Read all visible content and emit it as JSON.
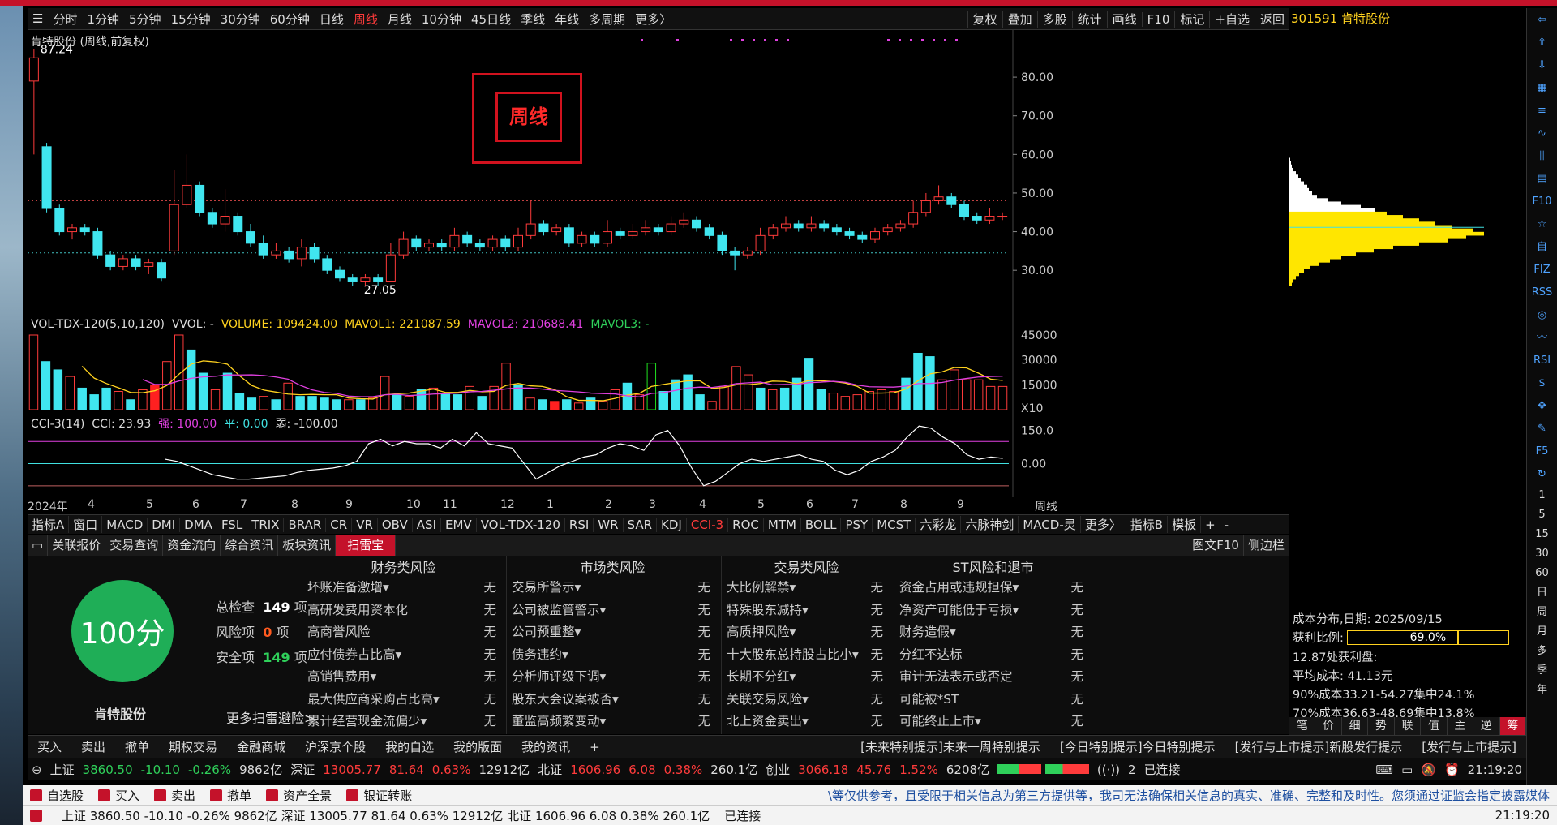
{
  "periods": [
    "分时",
    "1分钟",
    "5分钟",
    "15分钟",
    "30分钟",
    "60分钟",
    "日线",
    "周线",
    "月线",
    "10分钟",
    "45日线",
    "季线",
    "年线",
    "多周期",
    "更多〉"
  ],
  "active_period": "周线",
  "toolbar": [
    "复权",
    "叠加",
    "多股",
    "统计",
    "画线",
    "F10",
    "标记",
    "+自选",
    "返回"
  ],
  "stock": {
    "code": "301591",
    "name": "肯特股份",
    "title": "肯特股份 (周线,前复权)",
    "max_label": "87.24",
    "min_label": "27.05",
    "overlay_label": "周线"
  },
  "price_axis": [
    "80.00",
    "70.00",
    "60.00",
    "50.00",
    "40.00",
    "30.00"
  ],
  "vol_legend": {
    "name": "VOL-TDX-120(5,10,120)",
    "vvol": "VVOL: -",
    "volume": "VOLUME: 109424.00",
    "mavol1": "MAVOL1: 221087.59",
    "mavol2": "MAVOL2: 210688.41",
    "mavol3": "MAVOL3: -"
  },
  "vol_axis": [
    "45000",
    "30000",
    "15000",
    "X10"
  ],
  "cci_legend": {
    "name": "CCI-3(14)",
    "cci": "CCI: 23.93",
    "strong": "强: 100.00",
    "flat": "平: 0.00",
    "weak": "弱: -100.00"
  },
  "cci_axis": [
    "150.0",
    "0.00"
  ],
  "x_axis": [
    "2024年",
    "4",
    "5",
    "6",
    "7",
    "8",
    "9",
    "10",
    "11",
    "12",
    "1",
    "2",
    "3",
    "4",
    "5",
    "6",
    "7",
    "8",
    "9",
    "周线"
  ],
  "indicator_tabs": [
    "指标A",
    "窗口",
    "MACD",
    "DMI",
    "DMA",
    "FSL",
    "TRIX",
    "BRAR",
    "CR",
    "VR",
    "OBV",
    "ASI",
    "EMV",
    "VOL-TDX-120",
    "RSI",
    "WR",
    "SAR",
    "KDJ",
    "CCI-3",
    "ROC",
    "MTM",
    "BOLL",
    "PSY",
    "MCST",
    "六彩龙",
    "六脉神剑",
    "MACD-灵",
    "更多〉",
    "指标B",
    "模板",
    "+",
    "-"
  ],
  "active_indicator": "CCI-3",
  "info_tabs": [
    "关联报价",
    "交易查询",
    "资金流向",
    "综合资讯",
    "板块资讯",
    "扫雷宝"
  ],
  "active_info": "扫雷宝",
  "info_right": [
    "图文F10",
    "侧边栏"
  ],
  "risk": {
    "score": "100分",
    "total_label": "总检查",
    "total": "149",
    "total_unit": "项",
    "risk_label": "风险项",
    "risk": "0",
    "risk_unit": "项",
    "safe_label": "安全项",
    "safe": "149",
    "safe_unit": "项",
    "name": "肯特股份",
    "more": "更多扫雷避险>",
    "columns": [
      {
        "title": "财务类风险",
        "items": [
          [
            "坏账准备激增▾",
            "无"
          ],
          [
            "高研发费用资本化",
            "无"
          ],
          [
            "高商誉风险",
            "无"
          ],
          [
            "应付债券占比高▾",
            "无"
          ],
          [
            "高销售费用▾",
            "无"
          ],
          [
            "最大供应商采购占比高▾",
            "无"
          ],
          [
            "累计经营现金流偏少▾",
            "无"
          ]
        ]
      },
      {
        "title": "市场类风险",
        "items": [
          [
            "交易所警示▾",
            "无"
          ],
          [
            "公司被监管警示▾",
            "无"
          ],
          [
            "公司预重整▾",
            "无"
          ],
          [
            "债务违约▾",
            "无"
          ],
          [
            "分析师评级下调▾",
            "无"
          ],
          [
            "股东大会议案被否▾",
            "无"
          ],
          [
            "董监高频繁变动▾",
            "无"
          ]
        ]
      },
      {
        "title": "交易类风险",
        "items": [
          [
            "大比例解禁▾",
            "无"
          ],
          [
            "特殊股东减持▾",
            "无"
          ],
          [
            "高质押风险▾",
            "无"
          ],
          [
            "十大股东总持股占比小▾",
            "无"
          ],
          [
            "长期不分红▾",
            "无"
          ],
          [
            "关联交易风险▾",
            "无"
          ],
          [
            "北上资金卖出▾",
            "无"
          ]
        ]
      },
      {
        "title": "ST风险和退市",
        "items": [
          [
            "资金占用或违规担保▾",
            "无"
          ],
          [
            "净资产可能低于亏损▾",
            "无"
          ],
          [
            "财务造假▾",
            "无"
          ],
          [
            "分红不达标",
            "无"
          ],
          [
            "审计无法表示或否定",
            "无"
          ],
          [
            "可能被*ST",
            "无"
          ],
          [
            "可能终止上市▾",
            "无"
          ]
        ]
      }
    ]
  },
  "cost": {
    "date_label": "成本分布,日期:",
    "date": "2025/09/15",
    "profit_label": "获利比例:",
    "profit": "69.0%",
    "profit_value": 0.69,
    "line1": "12.87处获利盘:",
    "line2": "平均成本: 41.13元",
    "line3": "90%成本33.21-54.27集中24.1%",
    "line4": "70%成本36.63-48.69集中13.8%",
    "buttons": [
      "笔",
      "价",
      "细",
      "势",
      "联",
      "值",
      "主",
      "逆",
      "筹"
    ],
    "active_button": "筹"
  },
  "actions": [
    "买入",
    "卖出",
    "撤单",
    "期权交易",
    "金融商城",
    "沪深京个股",
    "我的自选",
    "我的版面",
    "我的资讯",
    "+",
    "[未来特别提示]未来一周特别提示",
    "[今日特别提示]今日特别提示",
    "[发行与上市提示]新股发行提示",
    "[发行与上市提示]"
  ],
  "status": {
    "sh_label": "上证",
    "sh": "3860.50",
    "sh_chg": "-10.10",
    "sh_pct": "-0.26%",
    "sh_amt": "9862亿",
    "sz_label": "深证",
    "sz": "13005.77",
    "sz_chg": "81.64",
    "sz_pct": "0.63%",
    "sz_amt": "12912亿",
    "bz_label": "北证",
    "bz": "1606.96",
    "bz_chg": "6.08",
    "bz_pct": "0.38%",
    "bz_amt": "260.1亿",
    "cy_label": "创业",
    "cy": "3066.18",
    "cy_chg": "45.76",
    "cy_pct": "1.52%",
    "cy_amt": "6208亿",
    "conn": "已连接",
    "conn_count": "2",
    "time": "21:19:20"
  },
  "bottom1": {
    "items": [
      "自选股",
      "买入",
      "卖出",
      "撤单",
      "资产全景",
      "银证转账"
    ],
    "notice": "\\等仅供参考，且受限于相关信息为第三方提供等，我司无法确保相关信息的真实、准确、完整和及时性。您须通过证监会指定披露媒体"
  },
  "bottom2": {
    "text": "上证 3860.50  -10.10  -0.26%  9862亿  深证 13005.77  81.64  0.63%  12912亿 北证 1606.96  6.08  0.38%  260.1亿",
    "conn": "已连接",
    "time": "21:19:20"
  },
  "right_icons": [
    "back-arrow-icon",
    "up-icon",
    "down-icon",
    "grid-icon",
    "list-icon",
    "chart-icon",
    "candle-icon",
    "news-icon",
    "f10-icon",
    "star-icon",
    "self-icon",
    "fiz-icon",
    "rss-icon",
    "globe-icon",
    "wave-icon",
    "rsi-icon",
    "money-icon",
    "move-icon",
    "pencil-icon",
    "f5-icon",
    "refresh-icon"
  ],
  "right_labels": [
    "1",
    "5",
    "15",
    "30",
    "60",
    "日",
    "周",
    "月",
    "多",
    "季",
    "年"
  ],
  "chart_data": {
    "type": "candlestick",
    "ylim": [
      25,
      88
    ],
    "candles": [
      [
        79,
        85,
        87.24,
        60
      ],
      [
        62,
        46,
        63,
        45
      ],
      [
        46,
        40,
        47,
        39
      ],
      [
        40,
        41,
        42,
        38
      ],
      [
        41,
        40,
        42,
        39
      ],
      [
        40,
        34,
        41,
        33
      ],
      [
        34,
        31,
        35,
        30
      ],
      [
        31,
        33,
        34,
        30
      ],
      [
        33,
        31,
        34,
        30
      ],
      [
        31,
        32,
        33,
        29
      ],
      [
        32,
        28,
        33,
        27.05
      ],
      [
        35,
        47,
        56,
        34
      ],
      [
        47,
        52,
        60,
        46
      ],
      [
        52,
        45,
        53,
        44
      ],
      [
        45,
        42,
        46,
        41
      ],
      [
        42,
        44,
        51,
        40
      ],
      [
        44,
        40,
        45,
        39
      ],
      [
        40,
        37,
        42,
        36
      ],
      [
        37,
        34,
        39,
        33
      ],
      [
        34,
        35,
        37,
        33
      ],
      [
        35,
        33,
        36,
        32
      ],
      [
        33,
        36,
        38,
        31
      ],
      [
        36,
        33,
        37,
        32
      ],
      [
        33,
        30,
        34,
        29
      ],
      [
        30,
        28,
        31,
        27
      ],
      [
        28,
        27,
        29,
        26
      ],
      [
        27,
        28,
        29,
        26
      ],
      [
        28,
        27,
        29,
        26
      ],
      [
        27,
        34,
        37,
        27
      ],
      [
        34,
        38,
        40,
        33
      ],
      [
        38,
        36,
        39,
        35
      ],
      [
        36,
        37,
        38,
        35
      ],
      [
        37,
        36,
        38,
        35
      ],
      [
        36,
        39,
        41,
        35
      ],
      [
        39,
        37,
        40,
        36
      ],
      [
        37,
        36,
        38,
        35
      ],
      [
        36,
        38,
        39,
        35
      ],
      [
        38,
        36,
        39,
        35
      ],
      [
        36,
        39,
        41,
        35
      ],
      [
        39,
        42,
        48,
        38
      ],
      [
        42,
        40,
        43,
        39
      ],
      [
        40,
        41,
        42,
        39
      ],
      [
        41,
        37,
        42,
        36
      ],
      [
        37,
        39,
        40,
        36
      ],
      [
        39,
        37,
        40,
        36
      ],
      [
        37,
        40,
        43,
        36
      ],
      [
        40,
        39,
        41,
        38
      ],
      [
        39,
        40,
        42,
        38
      ],
      [
        40,
        41,
        43,
        39
      ],
      [
        41,
        40,
        42,
        39
      ],
      [
        40,
        42,
        44,
        39
      ],
      [
        42,
        43,
        45,
        41
      ],
      [
        43,
        41,
        44,
        40
      ],
      [
        41,
        39,
        42,
        38
      ],
      [
        39,
        35,
        40,
        34
      ],
      [
        35,
        34,
        36,
        30
      ],
      [
        34,
        35,
        36,
        33
      ],
      [
        35,
        39,
        41,
        34
      ],
      [
        39,
        41,
        42,
        38
      ],
      [
        41,
        42,
        44,
        40
      ],
      [
        42,
        41,
        43,
        40
      ],
      [
        41,
        42,
        44,
        40
      ],
      [
        42,
        41,
        43,
        40
      ],
      [
        41,
        40,
        42,
        39
      ],
      [
        40,
        39,
        41,
        38
      ],
      [
        39,
        38,
        40,
        37
      ],
      [
        38,
        40,
        41,
        37
      ],
      [
        40,
        41,
        42,
        39
      ],
      [
        41,
        42,
        43,
        40
      ],
      [
        42,
        45,
        48,
        41
      ],
      [
        45,
        48,
        50,
        44
      ],
      [
        48,
        49,
        52,
        47
      ],
      [
        49,
        47,
        50,
        46
      ],
      [
        47,
        44,
        48,
        43
      ],
      [
        44,
        43,
        45,
        42
      ],
      [
        43,
        44,
        46,
        42
      ],
      [
        44,
        44,
        45,
        43
      ]
    ],
    "volume": [
      45000,
      29000,
      24000,
      20000,
      13000,
      9000,
      13000,
      11000,
      6000,
      12000,
      15000,
      29000,
      45000,
      36000,
      22000,
      12000,
      22000,
      10000,
      7000,
      8000,
      6000,
      16000,
      8000,
      8000,
      7000,
      6000,
      6000,
      6000,
      7000,
      20000,
      9000,
      8000,
      12000,
      13000,
      10000,
      9000,
      14000,
      8000,
      14000,
      28000,
      15000,
      7000,
      6000,
      5000,
      6000,
      4000,
      7000,
      5000,
      12000,
      16000,
      9000,
      28000,
      11000,
      18000,
      21000,
      9000,
      5000,
      14000,
      26000,
      21000,
      13000,
      12000,
      13000,
      19000,
      31000,
      12000,
      10000,
      8000,
      9000,
      11000,
      12000,
      11000,
      19000,
      34000,
      32000,
      18000,
      24000,
      18000,
      18000,
      14000,
      14000
    ],
    "cci": [
      null,
      null,
      null,
      null,
      null,
      null,
      null,
      null,
      null,
      null,
      null,
      20,
      10,
      -10,
      -30,
      -50,
      -60,
      -70,
      -70,
      -65,
      -60,
      -55,
      -40,
      -30,
      -25,
      -20,
      -10,
      10,
      90,
      110,
      80,
      100,
      90,
      90,
      70,
      110,
      80,
      140,
      90,
      80,
      70,
      0,
      -70,
      -40,
      -10,
      10,
      30,
      40,
      70,
      90,
      80,
      60,
      130,
      150,
      80,
      -20,
      -100,
      -80,
      -40,
      0,
      20,
      10,
      20,
      30,
      40,
      20,
      10,
      -30,
      -50,
      -30,
      10,
      30,
      60,
      120,
      170,
      160,
      120,
      90,
      40,
      20,
      30,
      23.93
    ],
    "cci_levels": [
      100,
      0,
      -100
    ],
    "cci_ylim": [
      -130,
      200
    ],
    "profile": [
      0,
      1,
      2,
      3,
      5,
      8,
      11,
      14,
      18,
      22,
      24,
      28,
      34,
      48,
      64,
      88,
      105,
      120,
      140,
      160,
      180,
      200,
      226,
      240,
      218,
      196,
      160,
      128,
      104,
      82,
      64,
      50,
      36,
      26,
      18,
      12,
      8,
      5,
      3
    ]
  }
}
